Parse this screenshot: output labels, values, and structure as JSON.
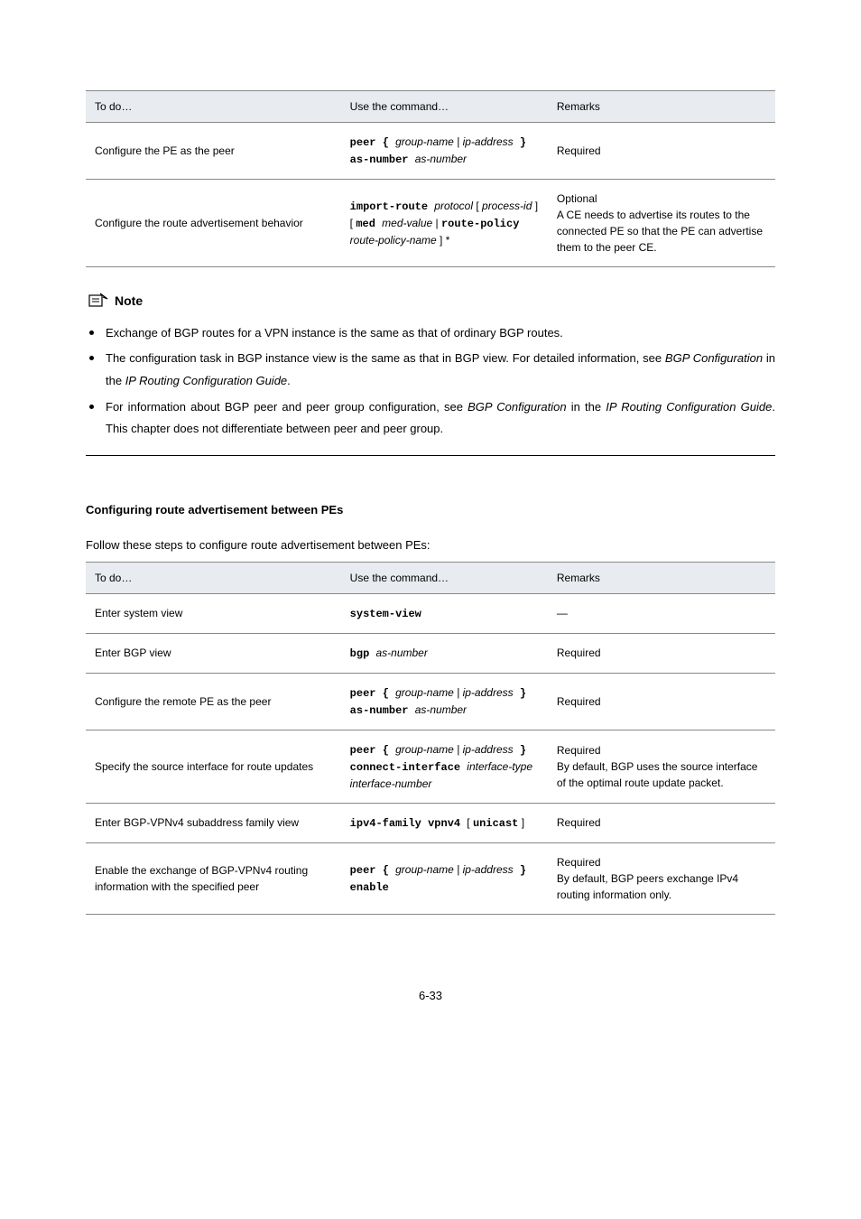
{
  "table1": {
    "headers": [
      "To do…",
      "Use the command…",
      "Remarks"
    ],
    "rows": [
      {
        "todo": "Configure the PE as the peer",
        "cmd_pre": "peer ",
        "cmd_open": "{ ",
        "cmd_inner": "group-name | ip-address",
        "cmd_close": " }",
        "cmd_post": " as-number as-number",
        "remarks_single": "Required"
      },
      {
        "todo": "Configure the route advertisement behavior",
        "cmd_pre": "import-route ",
        "cmd_italic1": "protocol",
        "cmd_mid1": " [ ",
        "cmd_italic2": "process-id",
        "cmd_mid2": " ] [ ",
        "cmd_bold1": "med ",
        "cmd_italic3": "med-value",
        "cmd_mid3": " | ",
        "cmd_bold2": "route-policy ",
        "cmd_italic4": "route-policy-name",
        "cmd_mid4": " ] *",
        "remarks_line1": "Optional",
        "remarks_line2": "A CE needs to advertise its routes to the connected PE so that the PE can advertise them to the peer CE."
      }
    ]
  },
  "note": {
    "label": "Note",
    "bullets": [
      "Exchange of BGP routes for a VPN instance is the same as that of ordinary BGP routes.",
      "The configuration task in BGP instance view is the same as that in BGP view. For detailed information, see {i}BGP Configuration{/i} in the {i}IP Routing Configuration Guide{/i}.",
      "For information about BGP peer and peer group configuration, see {i}BGP Configuration{/i} in the {i}IP Routing Configuration Guide{/i}. This chapter does not differentiate between peer and peer group."
    ]
  },
  "section_title": "Configuring route advertisement between PEs",
  "steps_intro": "Follow these steps to configure route advertisement between PEs:",
  "table2": {
    "headers": [
      "To do…",
      "Use the command…",
      "Remarks"
    ],
    "rows": [
      {
        "todo": "Enter system view",
        "cmd": "system-view",
        "rem": "—"
      },
      {
        "todo": "Enter BGP view",
        "cmd_pre": "bgp ",
        "cmd_italic": "as-number",
        "rem": "Required"
      },
      {
        "todo": "Configure the remote PE as the peer",
        "cmd_pre": "peer ",
        "cmd_open": "{ ",
        "cmd_inner": "group-name | ip-address",
        "cmd_close": " }",
        "cmd_post_pre": " as-number ",
        "cmd_post_it": "as-number",
        "rem": "Required"
      },
      {
        "todo": "Specify the source interface for route updates",
        "cmd_pre": "peer ",
        "cmd_open": "{ ",
        "cmd_inner": "group-name | ip-address",
        "cmd_close": " }",
        "cmd_post": " connect-interface ",
        "cmd_tail_it": "interface-type interface-number",
        "rem1": "Required",
        "rem2": "By default, BGP uses the source interface of the optimal route update packet."
      },
      {
        "todo": "Enter BGP-VPNv4 subaddress family view",
        "cmd_pre": "ipv4-family vpnv4 ",
        "cmd_open": "[ ",
        "cmd_bold": "unicast",
        "cmd_close": " ]",
        "rem": "Required"
      },
      {
        "todo": "Enable the exchange of BGP-VPNv4 routing information with the specified peer",
        "cmd_pre": "peer ",
        "cmd_open": "{ ",
        "cmd_inner": "group-name | ip-address",
        "cmd_close": " }",
        "cmd_post": " enable",
        "rem1": "Required",
        "rem2": "By default, BGP peers exchange IPv4 routing information only."
      }
    ]
  },
  "page_num": "6-33"
}
